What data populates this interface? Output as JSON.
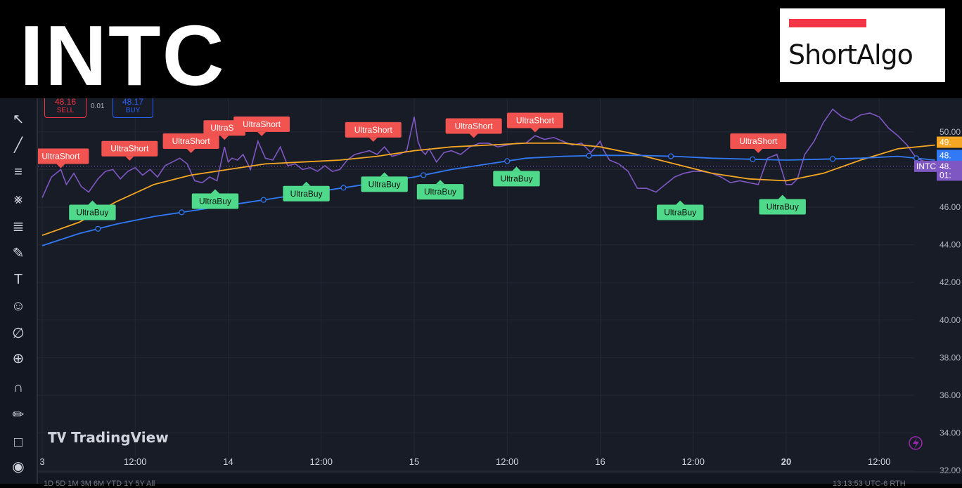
{
  "header": {
    "ticker": "INTC",
    "logo_text": "ShortAlgo"
  },
  "order_panel": {
    "sell_price": "48.16",
    "sell_label": "SELL",
    "spread": "0.01",
    "buy_price": "48.17",
    "buy_label": "BUY"
  },
  "watermark": "TradingView",
  "symbol_badge": "INTC",
  "colors": {
    "bg": "#181c27",
    "price": "#7e57c2",
    "ma_fast": "#f5a623",
    "ma_slow": "#3179f5",
    "short": "#f05350",
    "buy": "#4fd98a",
    "grid": "#232733"
  },
  "toolbar": {
    "icons": [
      "cursor-icon",
      "trendline-icon",
      "fib-icon",
      "pattern-icon",
      "forecast-icon",
      "brush-icon",
      "text-icon",
      "emoji-icon",
      "ruler-icon",
      "zoom-icon",
      "magnet-icon",
      "lock-draw-icon",
      "lock-icon",
      "eye-icon"
    ]
  },
  "bottom_bar": {
    "periods": "1D  5D  1M  3M  6M  YTD  1Y  5Y  All",
    "clock": "13:13:53 UTC-6  RTH"
  },
  "chart_data": {
    "type": "line",
    "title": "",
    "x_ticks": [
      {
        "t": 0.0,
        "label": "3"
      },
      {
        "t": 0.5,
        "label": "12:00"
      },
      {
        "t": 1.0,
        "label": "14"
      },
      {
        "t": 1.5,
        "label": "12:00"
      },
      {
        "t": 2.0,
        "label": "15"
      },
      {
        "t": 2.5,
        "label": "12:00"
      },
      {
        "t": 3.0,
        "label": "16"
      },
      {
        "t": 3.5,
        "label": "12:00"
      },
      {
        "t": 4.0,
        "label": "20"
      },
      {
        "t": 4.5,
        "label": "12:00"
      }
    ],
    "y_ticks": [
      "32.00",
      "34.00",
      "36.00",
      "38.00",
      "40.00",
      "42.00",
      "44.00",
      "46.00",
      "48.00",
      "50.00"
    ],
    "ylim": [
      31.3,
      50.8
    ],
    "xlim": [
      0.0,
      4.95
    ],
    "price_badges": [
      {
        "value": 49.45,
        "label": "49.",
        "color": "#f5a623"
      },
      {
        "value": 48.75,
        "label": "48.",
        "color": "#3179f5"
      },
      {
        "value": 48.17,
        "label": "48.",
        "color": "#7e57c2"
      },
      {
        "value": 47.7,
        "label": "01:",
        "color": "#7e57c2"
      }
    ],
    "series": [
      {
        "name": "INTC",
        "x": [
          0.0,
          0.05,
          0.1,
          0.13,
          0.17,
          0.21,
          0.25,
          0.3,
          0.34,
          0.38,
          0.42,
          0.46,
          0.5,
          0.54,
          0.58,
          0.62,
          0.66,
          0.7,
          0.74,
          0.78,
          0.82,
          0.86,
          0.9,
          0.94,
          0.98,
          1.0,
          1.02,
          1.05,
          1.08,
          1.12,
          1.16,
          1.2,
          1.24,
          1.28,
          1.32,
          1.36,
          1.4,
          1.44,
          1.48,
          1.52,
          1.56,
          1.6,
          1.64,
          1.68,
          1.72,
          1.76,
          1.8,
          1.84,
          1.88,
          1.92,
          1.96,
          2.0,
          2.02,
          2.04,
          2.06,
          2.08,
          2.12,
          2.16,
          2.2,
          2.25,
          2.3,
          2.35,
          2.4,
          2.45,
          2.5,
          2.55,
          2.6,
          2.65,
          2.7,
          2.75,
          2.8,
          2.85,
          2.9,
          2.95,
          3.0,
          3.02,
          3.05,
          3.1,
          3.15,
          3.2,
          3.25,
          3.3,
          3.35,
          3.4,
          3.45,
          3.5,
          3.55,
          3.6,
          3.65,
          3.7,
          3.75,
          3.8,
          3.85,
          3.9,
          3.95,
          4.0,
          4.03,
          4.06,
          4.1,
          4.15,
          4.2,
          4.25,
          4.3,
          4.35,
          4.4,
          4.45,
          4.5,
          4.55,
          4.6,
          4.65,
          4.7,
          4.75,
          4.8
        ],
        "y": [
          46.5,
          47.6,
          48.0,
          47.2,
          47.8,
          47.1,
          46.8,
          47.5,
          47.9,
          48.0,
          47.5,
          47.9,
          48.1,
          47.7,
          48.0,
          47.6,
          48.2,
          48.4,
          48.6,
          48.3,
          47.4,
          47.3,
          47.6,
          47.4,
          49.2,
          48.4,
          48.6,
          48.5,
          48.8,
          48.0,
          49.5,
          48.6,
          48.5,
          49.2,
          48.2,
          48.3,
          48.0,
          48.1,
          47.9,
          48.2,
          47.9,
          48.0,
          48.5,
          48.8,
          48.9,
          49.0,
          48.8,
          49.2,
          48.7,
          48.8,
          49.0,
          50.8,
          49.5,
          49.0,
          48.8,
          49.1,
          48.4,
          48.9,
          49.0,
          48.8,
          49.2,
          49.4,
          49.4,
          49.2,
          49.3,
          49.4,
          49.4,
          49.8,
          49.6,
          49.7,
          49.5,
          49.3,
          49.4,
          48.9,
          49.5,
          49.0,
          48.5,
          48.3,
          47.9,
          47.0,
          47.0,
          46.8,
          47.2,
          47.6,
          47.8,
          47.9,
          47.9,
          47.8,
          47.6,
          47.3,
          47.4,
          47.3,
          47.2,
          48.6,
          48.8,
          47.2,
          47.2,
          47.5,
          48.8,
          49.5,
          50.5,
          51.2,
          50.8,
          50.6,
          50.9,
          51.0,
          50.8,
          50.2,
          49.8,
          49.3,
          48.6,
          48.4,
          48.1
        ]
      },
      {
        "name": "",
        "x": [
          0.0,
          0.2,
          0.4,
          0.6,
          0.8,
          1.0,
          1.2,
          1.4,
          1.6,
          1.8,
          2.0,
          2.2,
          2.4,
          2.6,
          2.8,
          3.0,
          3.2,
          3.4,
          3.6,
          3.8,
          4.0,
          4.2,
          4.4,
          4.6,
          4.8
        ],
        "y": [
          44.5,
          45.2,
          46.3,
          47.2,
          47.7,
          48.0,
          48.3,
          48.4,
          48.5,
          48.7,
          49.0,
          49.2,
          49.3,
          49.4,
          49.4,
          49.2,
          48.8,
          48.3,
          47.8,
          47.5,
          47.4,
          47.8,
          48.5,
          49.1,
          49.3
        ]
      },
      {
        "name": "",
        "x": [
          0.0,
          0.2,
          0.4,
          0.6,
          0.8,
          1.0,
          1.2,
          1.4,
          1.6,
          1.8,
          2.0,
          2.2,
          2.4,
          2.6,
          2.8,
          3.0,
          3.2,
          3.4,
          3.6,
          3.8,
          4.0,
          4.2,
          4.4,
          4.6,
          4.8
        ],
        "y": [
          43.95,
          44.6,
          45.1,
          45.5,
          45.8,
          46.1,
          46.4,
          46.7,
          47.0,
          47.3,
          47.6,
          48.0,
          48.3,
          48.6,
          48.7,
          48.75,
          48.75,
          48.7,
          48.6,
          48.55,
          48.5,
          48.55,
          48.6,
          48.7,
          48.5
        ]
      }
    ],
    "annotations": [
      {
        "text": "UltraShort",
        "kind": "short",
        "x": 0.1,
        "y": 47.7
      },
      {
        "text": "UltraShort",
        "kind": "short",
        "x": 0.47,
        "y": 48.1
      },
      {
        "text": "UltraShort",
        "kind": "short",
        "x": 0.8,
        "y": 48.5
      },
      {
        "text": "UltraSh",
        "kind": "short",
        "x": 0.98,
        "y": 49.2
      },
      {
        "text": "UltraShort",
        "kind": "short",
        "x": 1.18,
        "y": 49.4
      },
      {
        "text": "UltraShort",
        "kind": "short",
        "x": 1.78,
        "y": 49.1
      },
      {
        "text": "UltraShort",
        "kind": "short",
        "x": 2.32,
        "y": 49.3
      },
      {
        "text": "UltraShort",
        "kind": "short",
        "x": 2.65,
        "y": 49.6
      },
      {
        "text": "UltraShort",
        "kind": "short",
        "x": 3.85,
        "y": 48.5
      },
      {
        "text": "UltraBuy",
        "kind": "buy",
        "x": 0.27,
        "y": 46.8
      },
      {
        "text": "UltraBuy",
        "kind": "buy",
        "x": 0.93,
        "y": 47.4
      },
      {
        "text": "UltraBuy",
        "kind": "buy",
        "x": 1.42,
        "y": 47.8
      },
      {
        "text": "UltraBuy",
        "kind": "buy",
        "x": 1.84,
        "y": 48.3
      },
      {
        "text": "UltraBuy",
        "kind": "buy",
        "x": 2.14,
        "y": 47.9
      },
      {
        "text": "UltraBuy",
        "kind": "buy",
        "x": 2.55,
        "y": 48.6
      },
      {
        "text": "UltraBuy",
        "kind": "buy",
        "x": 3.43,
        "y": 46.8
      },
      {
        "text": "UltraBuy",
        "kind": "buy",
        "x": 3.98,
        "y": 47.1
      }
    ]
  }
}
